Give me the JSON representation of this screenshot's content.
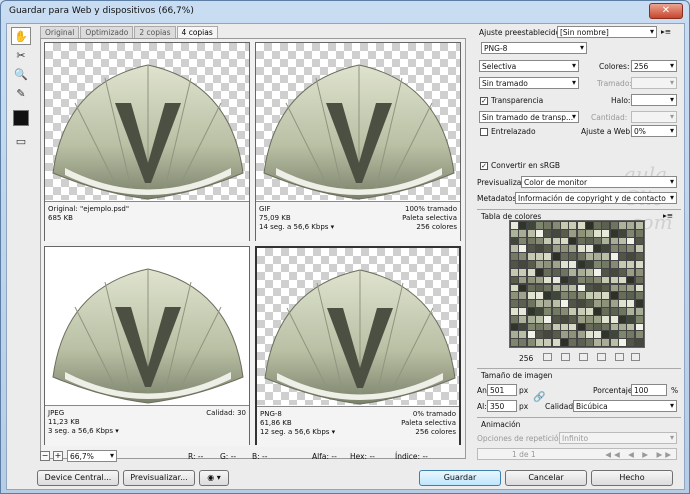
{
  "window": {
    "title": "Guardar para Web y dispositivos (66,7%)",
    "close": "✕"
  },
  "tabs": [
    "Original",
    "Optimizado",
    "2 copias",
    "4 copias"
  ],
  "panes": [
    {
      "left1": "Original: \"ejemplo.psd\"",
      "left2": "685 KB",
      "left3": "",
      "right1": "",
      "right2": "",
      "right3": ""
    },
    {
      "left1": "GIF",
      "left2": "75,09 KB",
      "left3": "14 seg. a 56,6 Kbps",
      "right1": "100% tramado",
      "right2": "Paleta selectiva",
      "right3": "256 colores"
    },
    {
      "left1": "JPEG",
      "left2": "11,23 KB",
      "left3": "3 seg. a 56,6 Kbps",
      "right1": "Calidad: 30",
      "right2": "",
      "right3": ""
    },
    {
      "left1": "PNG-8",
      "left2": "61,86 KB",
      "left3": "12 seg. a 56,6 Kbps",
      "right1": "0% tramado",
      "right2": "Paleta selectiva",
      "right3": "256 colores"
    }
  ],
  "statusbar": {
    "zoom": "66,7%",
    "r": "R: --",
    "g": "G: --",
    "b": "B: --",
    "alpha": "Alfa: --",
    "hex": "Hex: --",
    "index": "Índice: --"
  },
  "buttons": {
    "device_central": "Device Central...",
    "preview": "Previsualizar...",
    "save": "Guardar",
    "cancel": "Cancelar",
    "done": "Hecho"
  },
  "settings": {
    "preset_label": "Ajuste preestablecido:",
    "preset_value": "[Sin nombre]",
    "format": "PNG-8",
    "reduction": "Selectiva",
    "colors_label": "Colores:",
    "colors_value": "256",
    "dither": "Sin tramado",
    "dither_label": "Tramado:",
    "transparency": "Transparencia",
    "halo_label": "Halo:",
    "trans_dither": "Sin tramado de transp...",
    "amount_label": "Cantidad:",
    "interlaced": "Entrelazado",
    "websnap_label": "Ajuste a Web:",
    "websnap_value": "0%",
    "srgb": "Convertir en sRGB",
    "preview_label": "Previsualizar:",
    "preview_value": "Color de monitor",
    "metadata_label": "Metadatos:",
    "metadata_value": "Información de copyright y de contacto",
    "color_table_label": "Tabla de colores",
    "color_count": "256",
    "image_size_label": "Tamaño de imagen",
    "width_label": "An:",
    "width_value": "501",
    "height_label": "Al:",
    "height_value": "350",
    "px": "px",
    "percent_label": "Porcentaje:",
    "percent_value": "100",
    "percent_unit": "%",
    "quality_label": "Calidad:",
    "quality_value": "Bicúbica",
    "animation_label": "Animación",
    "loop_label": "Opciones de repetición:",
    "loop_value": "Infinito",
    "frame": "1 de 1"
  },
  "watermark": "aula Clic .com",
  "palette_colors": [
    "#e7e9dc",
    "#c9cdb6",
    "#a7ad96",
    "#8d9279",
    "#737963",
    "#5b6150",
    "#45493d",
    "#30352c",
    "#d7dcc6",
    "#b9bea6",
    "#9ea48b",
    "#868c73",
    "#6e7460",
    "#585d4b",
    "#41463a",
    "#2c3026",
    "#f1f2ea",
    "#dee2cf",
    "#c4c9b2",
    "#adb39a",
    "#989f86",
    "#7f866e",
    "#676d59",
    "#505547"
  ]
}
